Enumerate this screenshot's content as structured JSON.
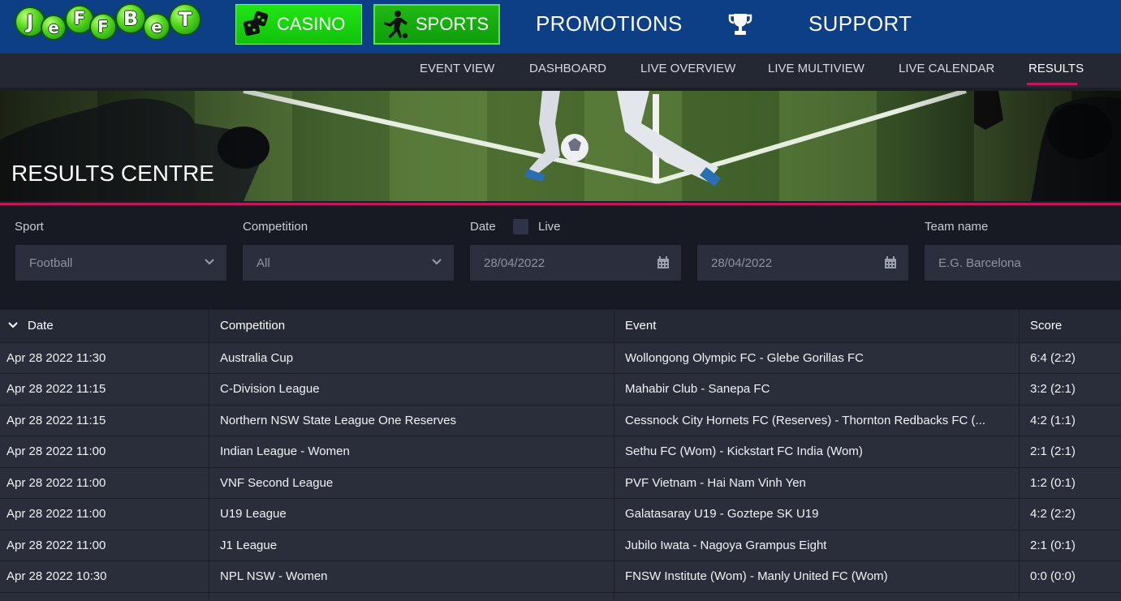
{
  "brand": {
    "logo_letters": [
      "J",
      "e",
      "F",
      "F",
      "B",
      "e",
      "T"
    ],
    "colors": {
      "topbar": "#0c3f85",
      "green": "#22e614",
      "accent": "#c2185b"
    }
  },
  "topnav": {
    "casino": "CASINO",
    "sports": "SPORTS",
    "promotions": "PROMOTIONS",
    "support": "SUPPORT",
    "icons": {
      "casino": "dice-icon",
      "sports": "soccer-player-icon",
      "trophy": "trophy-icon"
    }
  },
  "subnav": {
    "items": [
      "EVENT VIEW",
      "DASHBOARD",
      "LIVE OVERVIEW",
      "LIVE MULTIVIEW",
      "LIVE CALENDAR",
      "RESULTS"
    ],
    "active": "RESULTS"
  },
  "banner": {
    "title": "RESULTS CENTRE"
  },
  "filters": {
    "sport_label": "Sport",
    "sport_value": "Football",
    "competition_label": "Competition",
    "competition_value": "All",
    "date_label": "Date",
    "live_label": "Live",
    "date_from": "28/04/2022",
    "date_to": "28/04/2022",
    "team_label": "Team name",
    "team_placeholder": "E.G. Barcelona"
  },
  "table": {
    "headers": {
      "date": "Date",
      "competition": "Competition",
      "event": "Event",
      "score": "Score"
    },
    "rows": [
      {
        "date": "Apr 28 2022 11:30",
        "competition": "Australia Cup",
        "event": "Wollongong Olympic FC - Glebe Gorillas FC",
        "score": "6:4 (2:2)"
      },
      {
        "date": "Apr 28 2022 11:15",
        "competition": "C-Division League",
        "event": "Mahabir Club - Sanepa FC",
        "score": "3:2 (2:1)"
      },
      {
        "date": "Apr 28 2022 11:15",
        "competition": "Northern NSW State League One Reserves",
        "event": "Cessnock City Hornets FC (Reserves) - Thornton Redbacks FC (...",
        "score": "4:2 (1:1)"
      },
      {
        "date": "Apr 28 2022 11:00",
        "competition": "Indian League - Women",
        "event": "Sethu FC (Wom) - Kickstart FC India (Wom)",
        "score": "2:1 (2:1)"
      },
      {
        "date": "Apr 28 2022 11:00",
        "competition": "VNF Second League",
        "event": "PVF Vietnam - Hai Nam Vinh Yen",
        "score": "1:2 (0:1)"
      },
      {
        "date": "Apr 28 2022 11:00",
        "competition": "U19 League",
        "event": "Galatasaray U19 - Goztepe SK U19",
        "score": "4:2 (2:2)"
      },
      {
        "date": "Apr 28 2022 11:00",
        "competition": "J1 League",
        "event": "Jubilo Iwata - Nagoya Grampus Eight",
        "score": "2:1 (0:1)"
      },
      {
        "date": "Apr 28 2022 10:30",
        "competition": "NPL NSW - Women",
        "event": "FNSW Institute (Wom) - Manly United FC (Wom)",
        "score": "0:0 (0:0)"
      }
    ]
  }
}
